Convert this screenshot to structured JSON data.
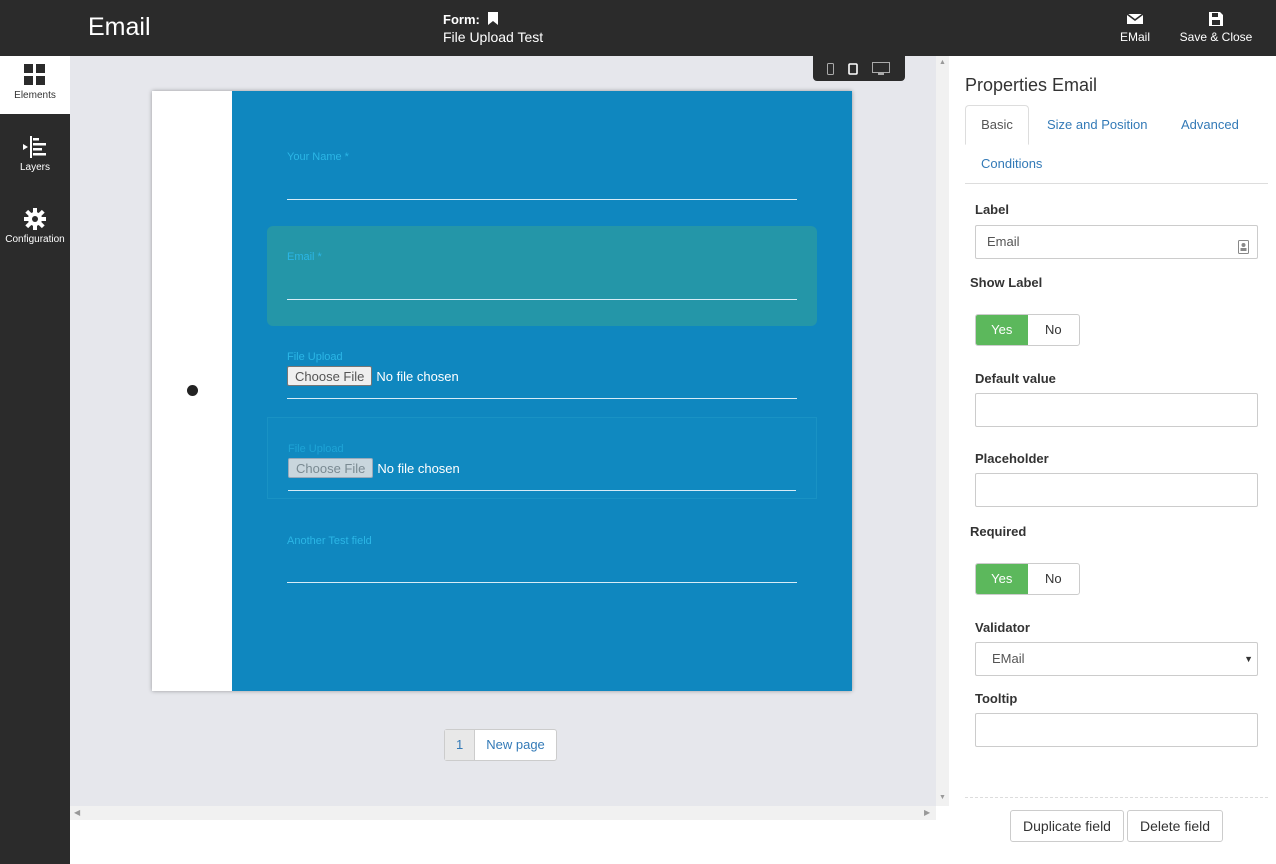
{
  "header": {
    "title": "Email",
    "form_label": "Form:",
    "form_name": "File Upload Test",
    "email_button": "EMail",
    "save_button": "Save & Close"
  },
  "sidebar": {
    "items": [
      {
        "label": "Elements",
        "icon": "grid-icon"
      },
      {
        "label": "Layers",
        "icon": "layers-icon"
      },
      {
        "label": "Configuration",
        "icon": "gear-icon"
      }
    ]
  },
  "form": {
    "fields": [
      {
        "label": "Your Name *"
      },
      {
        "label": "Email *"
      },
      {
        "label": "File Upload",
        "button": "Choose File",
        "status": "No file chosen"
      },
      {
        "label": "File Upload",
        "button": "Choose File",
        "status": "No file chosen"
      },
      {
        "label": "Another Test field"
      }
    ],
    "pagination": {
      "current": "1",
      "new_page": "New page"
    }
  },
  "properties": {
    "title": "Properties Email",
    "tabs": [
      "Basic",
      "Size and Position",
      "Advanced",
      "Conditions"
    ],
    "label": {
      "title": "Label",
      "value": "Email"
    },
    "show_label": {
      "title": "Show Label",
      "yes": "Yes",
      "no": "No",
      "selected": "Yes"
    },
    "default_value": {
      "title": "Default value",
      "value": ""
    },
    "placeholder": {
      "title": "Placeholder",
      "value": ""
    },
    "required": {
      "title": "Required",
      "yes": "Yes",
      "no": "No",
      "selected": "Yes"
    },
    "validator": {
      "title": "Validator",
      "value": "EMail"
    },
    "tooltip": {
      "title": "Tooltip",
      "value": ""
    },
    "duplicate_button": "Duplicate field",
    "delete_button": "Delete field"
  },
  "colors": {
    "topbar": "#2b2b2b",
    "form_background": "#0f87bf",
    "field_label": "#2bb6e6",
    "toggle_on": "#5cb85c",
    "link": "#337ab7"
  }
}
